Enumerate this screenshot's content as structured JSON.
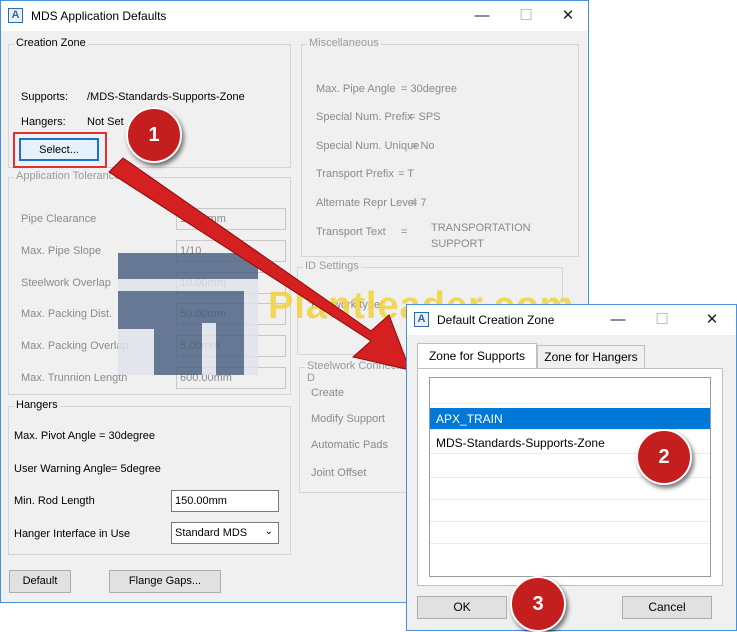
{
  "main_window": {
    "title": "MDS Application Defaults",
    "icon": "app-logo-icon",
    "creation_zone": {
      "title": "Creation Zone",
      "supports_label": "Supports:",
      "supports_value": "/MDS-Standards-Supports-Zone",
      "hangers_label": "Hangers:",
      "hangers_value": "Not Set",
      "select_label": "Select..."
    },
    "application_tolerances": {
      "title": "Application Tolerances",
      "rows": [
        {
          "label": "Pipe Clearance",
          "value": "10.00mm"
        },
        {
          "label": "Max. Pipe Slope",
          "value": "1/10"
        },
        {
          "label": "Steelwork Overlap",
          "value": "10.00mm"
        },
        {
          "label": "Max. Packing Dist.",
          "value": "50.00mm"
        },
        {
          "label": "Max. Packing Overlap",
          "value": "5.00mm"
        },
        {
          "label": "Max. Trunnion Length",
          "value": "600.00mm"
        }
      ]
    },
    "hangers": {
      "title": "Hangers",
      "max_pivot_label": "Max. Pivot Angle",
      "max_pivot_value": "= 30degree",
      "user_warning_label": "User Warning Angle",
      "user_warning_value": "= 5degree",
      "min_rod_label": "Min. Rod Length",
      "min_rod_value": "150.00mm",
      "interface_label": "Hanger Interface in Use",
      "interface_value": "Standard MDS"
    },
    "miscellaneous": {
      "title": "Miscellaneous",
      "rows": [
        {
          "label": "Max. Pipe Angle",
          "value": "= 30degree"
        },
        {
          "label": "Special Num. Prefix",
          "value": "= SPS"
        },
        {
          "label": "Special Num. Unique",
          "value": "= No"
        },
        {
          "label": "Transport Prefix",
          "value": "= T"
        },
        {
          "label": "Alternate Repr Level",
          "value": "= 7"
        }
      ],
      "transport_text_label": "Transport Text",
      "transport_text_eq": "=",
      "transport_text_value": "TRANSPORTATION SUPPORT"
    },
    "id_settings": {
      "title": "ID Settings",
      "pipework_label": "Pipework type:"
    },
    "steelwork": {
      "title": "Steelwork Connection D",
      "rows": [
        "Create",
        "Modify Support",
        "Automatic Pads",
        "Joint Offset"
      ]
    },
    "default_button": "Default",
    "flange_gaps_button": "Flange Gaps..."
  },
  "dialog": {
    "title": "Default Creation Zone",
    "tabs": [
      "Zone for Supports",
      "Zone for Hangers"
    ],
    "active_tab": 0,
    "list_items": [
      "",
      "APX_TRAIN",
      "MDS-Standards-Supports-Zone",
      "",
      "",
      "",
      ""
    ],
    "selected_index": 1,
    "ok_label": "OK",
    "cancel_label": "Cancel"
  },
  "watermark": {
    "text": "Plantleader.com",
    "color": "#f2d33a",
    "logo_color": "#4a5e80"
  },
  "callouts": [
    "1",
    "2",
    "3"
  ],
  "colors": {
    "accent": "#0078d7",
    "callout": "#c41e1e",
    "arrow": "#d42020"
  }
}
